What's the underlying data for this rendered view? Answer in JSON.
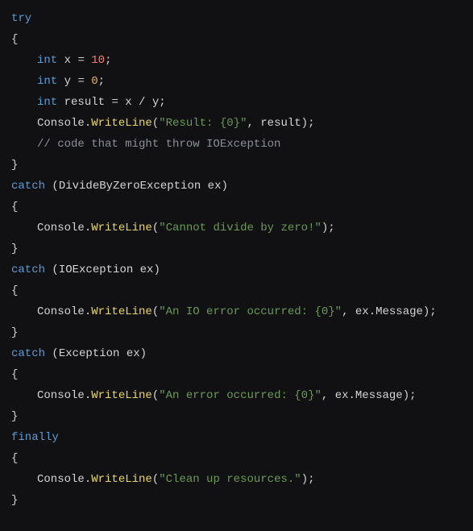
{
  "code": {
    "l1_try": "try",
    "l2_brace": "{",
    "l3_int": "int",
    "l3_x": " x ",
    "l3_eq": "= ",
    "l3_10": "10",
    "l3_semi": ";",
    "l4_int": "int",
    "l4_y": " y ",
    "l4_eq": "= ",
    "l4_0": "0",
    "l4_semi": ";",
    "l5_int": "int",
    "l5_result": " result ",
    "l5_eq": "= x / y;",
    "l6_cons": "Console",
    "l6_dot": ".",
    "l6_wl": "WriteLine",
    "l6_p1": "(",
    "l6_str": "\"Result: {0}\"",
    "l6_p2": ", result);",
    "l7_cmt": "// code that might throw IOException",
    "l8_brace": "}",
    "l9_catch": "catch",
    "l9_p1": " (",
    "l9_type": "DivideByZeroException",
    "l9_ex": " ex)",
    "l10_brace": "{",
    "l11_cons": "Console",
    "l11_dot": ".",
    "l11_wl": "WriteLine",
    "l11_p1": "(",
    "l11_str": "\"Cannot divide by zero!\"",
    "l11_p2": ");",
    "l12_brace": "}",
    "l13_catch": "catch",
    "l13_p1": " (",
    "l13_type": "IOException",
    "l13_ex": " ex)",
    "l14_brace": "{",
    "l15_cons": "Console",
    "l15_dot": ".",
    "l15_wl": "WriteLine",
    "l15_p1": "(",
    "l15_str": "\"An IO error occurred: {0}\"",
    "l15_p2": ", ex.Message);",
    "l16_brace": "}",
    "l17_catch": "catch",
    "l17_p1": " (",
    "l17_type": "Exception",
    "l17_ex": " ex)",
    "l18_brace": "{",
    "l19_cons": "Console",
    "l19_dot": ".",
    "l19_wl": "WriteLine",
    "l19_p1": "(",
    "l19_str": "\"An error occurred: {0}\"",
    "l19_p2": ", ex.Message);",
    "l20_brace": "}",
    "l21_fin": "finally",
    "l22_brace": "{",
    "l23_cons": "Console",
    "l23_dot": ".",
    "l23_wl": "WriteLine",
    "l23_p1": "(",
    "l23_str": "\"Clean up resources.\"",
    "l23_p2": ");",
    "l24_brace": "}"
  }
}
